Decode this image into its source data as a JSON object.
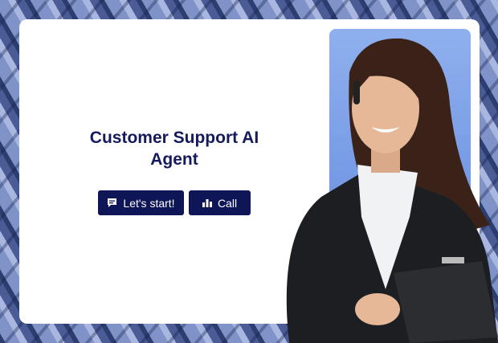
{
  "hero": {
    "title": "Customer Support AI Agent"
  },
  "buttons": [
    {
      "label": "Let's start!",
      "icon": "chat-icon"
    },
    {
      "label": "Call",
      "icon": "audio-bars-icon"
    }
  ],
  "colors": {
    "primary": "#0e1657",
    "title": "#141a5c",
    "panel": "#7a9de6"
  }
}
